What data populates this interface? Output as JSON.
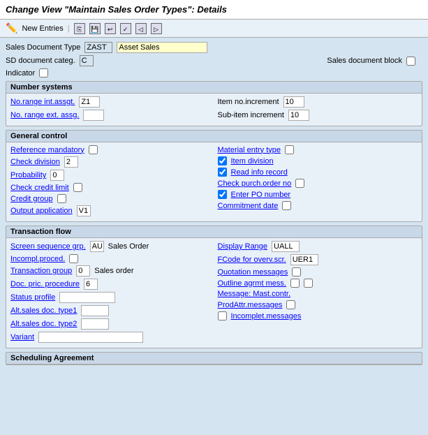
{
  "title": "Change View \"Maintain Sales Order Types\": Details",
  "toolbar": {
    "new_entries_label": "New Entries",
    "icons": [
      "copy-icon",
      "save-icon",
      "undo-icon",
      "check-icon",
      "prev-icon",
      "next-icon"
    ]
  },
  "fields": {
    "sales_document_type_label": "Sales Document Type",
    "sales_document_type_code": "ZAST",
    "sales_document_type_name": "Asset Sales",
    "sd_document_categ_label": "SD document categ.",
    "sd_document_categ_value": "C",
    "sales_document_block_label": "Sales document block",
    "indicator_label": "Indicator"
  },
  "sections": {
    "number_systems": {
      "title": "Number systems",
      "no_range_int_label": "No.range int.assgt.",
      "no_range_int_value": "Z1",
      "no_range_ext_label": "No. range ext. assg.",
      "no_range_ext_value": "",
      "item_no_increment_label": "Item no.increment",
      "item_no_increment_value": "10",
      "sub_item_increment_label": "Sub-item increment",
      "sub_item_increment_value": "10"
    },
    "general_control": {
      "title": "General control",
      "reference_mandatory_label": "Reference mandatory",
      "check_division_label": "Check division",
      "check_division_value": "2",
      "probability_label": "Probability",
      "probability_value": "0",
      "check_credit_limit_label": "Check credit limit",
      "credit_group_label": "Credit group",
      "output_application_label": "Output application",
      "output_application_value": "V1",
      "material_entry_type_label": "Material entry type",
      "item_division_label": "Item division",
      "item_division_checked": true,
      "read_info_record_label": "Read info record",
      "read_info_record_checked": true,
      "check_purch_order_no_label": "Check purch.order no",
      "enter_po_number_label": "Enter PO number",
      "enter_po_number_checked": true,
      "commitment_date_label": "Commitment  date"
    },
    "transaction_flow": {
      "title": "Transaction flow",
      "screen_sequence_grp_label": "Screen sequence grp.",
      "screen_sequence_grp_value": "AU",
      "screen_sequence_grp_text": "Sales Order",
      "incompl_proced_label": "Incompl.proced.",
      "transaction_group_label": "Transaction group",
      "transaction_group_value": "0",
      "transaction_group_text": "Sales order",
      "doc_pric_procedure_label": "Doc. pric. procedure",
      "doc_pric_procedure_value": "6",
      "status_profile_label": "Status profile",
      "alt_sales_doc_type1_label": "Alt.sales doc. type1",
      "alt_sales_doc_type2_label": "Alt.sales doc. type2",
      "variant_label": "Variant",
      "display_range_label": "Display Range",
      "display_range_value": "UALL",
      "fcode_for_overv_scr_label": "FCode for overv.scr.",
      "fcode_for_overv_scr_value": "UER1",
      "quotation_messages_label": "Quotation messages",
      "outline_agrmt_mess_label": "Outline agrmt mess.",
      "message_mast_contr_label": "Message: Mast.contr.",
      "prod_attr_messages_label": "ProdAttr.messages",
      "incomplet_messages_label": "Incomplet.messages"
    },
    "scheduling_agreement": {
      "title": "Scheduling Agreement"
    }
  }
}
